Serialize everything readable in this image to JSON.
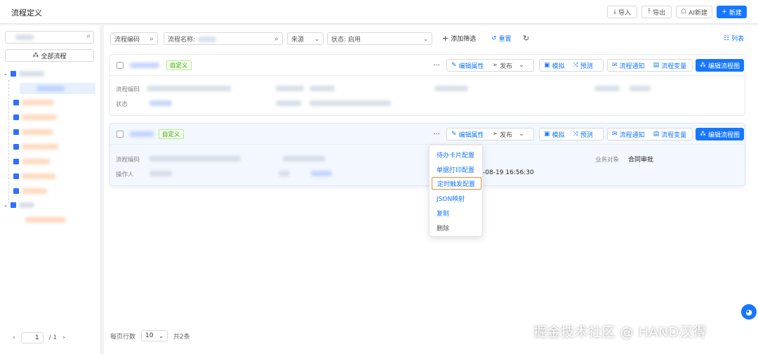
{
  "header": {
    "title": "流程定义",
    "import_label": "导入",
    "export_label": "导出",
    "ai_new_label": "AI新建",
    "new_label": "新建"
  },
  "sidebar": {
    "search_placeholder": "",
    "all_processes_label": "全部流程",
    "pager": {
      "current": "1",
      "total": "/ 1"
    }
  },
  "filters": {
    "process_code_placeholder": "流程编码",
    "process_name_placeholder": "流程名称:",
    "source_label": "来源",
    "status_label": "状态: 启用",
    "add_filter_label": "添加筛选",
    "reset_label": "重置",
    "list_view_label": "列表"
  },
  "cards": [
    {
      "tag": "自定义",
      "actions": {
        "edit_props": "编辑属性",
        "publish": "发布",
        "simulate": "模拟",
        "predict": "预测",
        "notify": "流程通知",
        "variables": "流程变量",
        "edit_diagram": "编辑流程图"
      },
      "fields": {
        "code_label": "流程编码",
        "status_label": "状态"
      }
    },
    {
      "tag": "自定义",
      "actions": {
        "edit_props": "编辑属性",
        "publish": "发布",
        "simulate": "模拟",
        "predict": "预测",
        "notify": "流程通知",
        "variables": "流程变量",
        "edit_diagram": "编辑流程图"
      },
      "fields": {
        "code_label": "流程编码",
        "operator_label": "操作人",
        "timestamp": "-08-19 16:56:30",
        "biz_object_label": "业务对象",
        "biz_object_value": "合同审批"
      }
    }
  ],
  "more_menu": {
    "items": [
      "待办卡片配置",
      "单据打印配置",
      "定时触发配置",
      "JSON映射",
      "复制",
      "删除"
    ],
    "active_index": 2
  },
  "footer": {
    "rows_per_page_label": "每页行数",
    "rows_per_page_value": "10",
    "total_label": "共2条"
  },
  "watermark": "掘金技术社区 @ HAND汉得",
  "colors": {
    "primary": "#1677ff",
    "tag_green": "#389e0d",
    "highlight_border": "#e98a3a"
  }
}
